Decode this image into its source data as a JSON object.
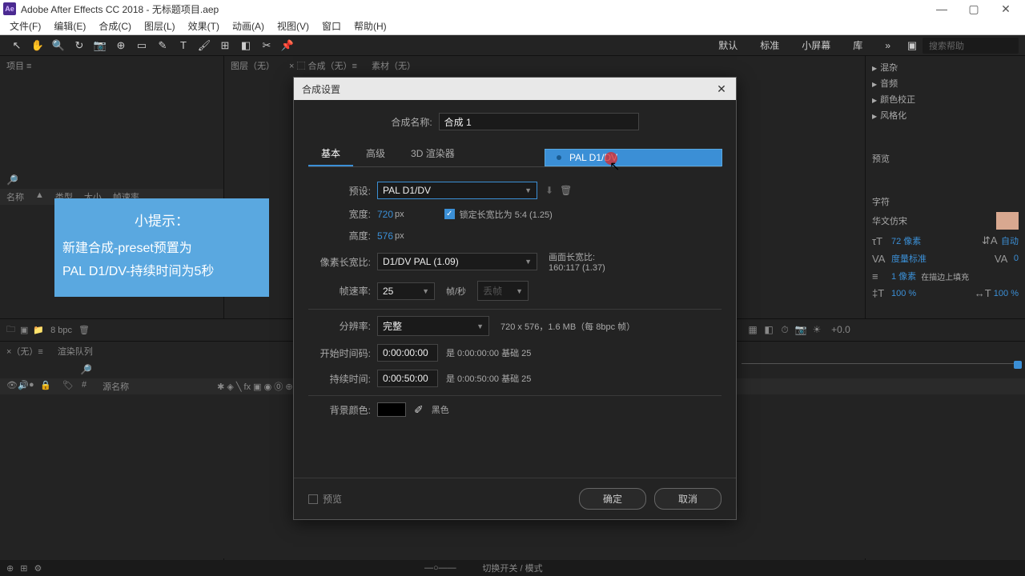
{
  "titlebar": {
    "app_icon": "Ae",
    "title": "Adobe After Effects CC 2018 - 无标题项目.aep"
  },
  "menu": [
    "文件(F)",
    "编辑(E)",
    "合成(C)",
    "图层(L)",
    "效果(T)",
    "动画(A)",
    "视图(V)",
    "窗口",
    "帮助(H)"
  ],
  "workspaces": {
    "items": [
      "默认",
      "标准",
      "小屏幕",
      "库"
    ],
    "more": "»",
    "search_placeholder": "搜索帮助"
  },
  "left_panel": {
    "tabs": [
      "项目 ≡"
    ],
    "cols": [
      "名称",
      "▲",
      "类型",
      "大小",
      "帧速率"
    ]
  },
  "center_panel": {
    "tabs": [
      "图层（无）",
      "× ⬚ 合成（无）≡",
      "素材（无）"
    ]
  },
  "right_panel": {
    "effects": [
      "混杂",
      "音频",
      "颜色校正",
      "风格化"
    ],
    "sections": {
      "preview": "预览",
      "char": "字符"
    },
    "font": "华文仿宋",
    "size": "72 像素",
    "leading": "自动",
    "tracking": "度量标准",
    "tracking_val": "0",
    "stroke": "1 像素",
    "stroke_pos": "在描边上填充",
    "vscale": "100 %",
    "hscale": "100 %"
  },
  "dialog": {
    "title": "合成设置",
    "name_label": "合成名称:",
    "name_value": "合成 1",
    "tabs": [
      "基本",
      "高级",
      "3D 渲染器"
    ],
    "preset_label": "预设:",
    "preset_value": "PAL D1/DV",
    "width_label": "宽度:",
    "width_value": "720",
    "px": "px",
    "height_label": "高度:",
    "height_value": "576",
    "lock_label": "锁定长宽比为 5:4 (1.25)",
    "par_label": "像素长宽比:",
    "par_value": "D1/DV PAL (1.09)",
    "frame_aspect_label": "画面长宽比:",
    "frame_aspect_value": "160:117 (1.37)",
    "fps_label": "帧速率:",
    "fps_value": "25",
    "fps_unit": "帧/秒",
    "fps_drop": "丢帧",
    "res_label": "分辨率:",
    "res_value": "完整",
    "res_info": "720 x 576，1.6 MB（每 8bpc 帧）",
    "start_label": "开始时间码:",
    "start_value": "0:00:00:00",
    "start_info": "是 0:00:00:00  基础 25",
    "duration_label": "持续时间:",
    "duration_value": "0:00:50:00",
    "duration_info": "是 0:00:50:00  基础 25",
    "bg_label": "背景颜色:",
    "bg_color": "#000000",
    "bg_name": "黑色",
    "preview_chk": "预览",
    "ok": "确定",
    "cancel": "取消"
  },
  "dropdown": {
    "item": "PAL D1/DV"
  },
  "tip": {
    "title": "小提示：",
    "line1": "新建合成-preset预置为",
    "line2": "PAL D1/DV-持续时间为5秒"
  },
  "timeline": {
    "bpc": "8 bpc",
    "tabs": [
      "×（无）≡",
      "渲染队列"
    ],
    "cols": [
      "源名称"
    ]
  },
  "statusbar": {
    "center": "切换开关 / 模式"
  },
  "tool_row2_zoom": "+0.0"
}
